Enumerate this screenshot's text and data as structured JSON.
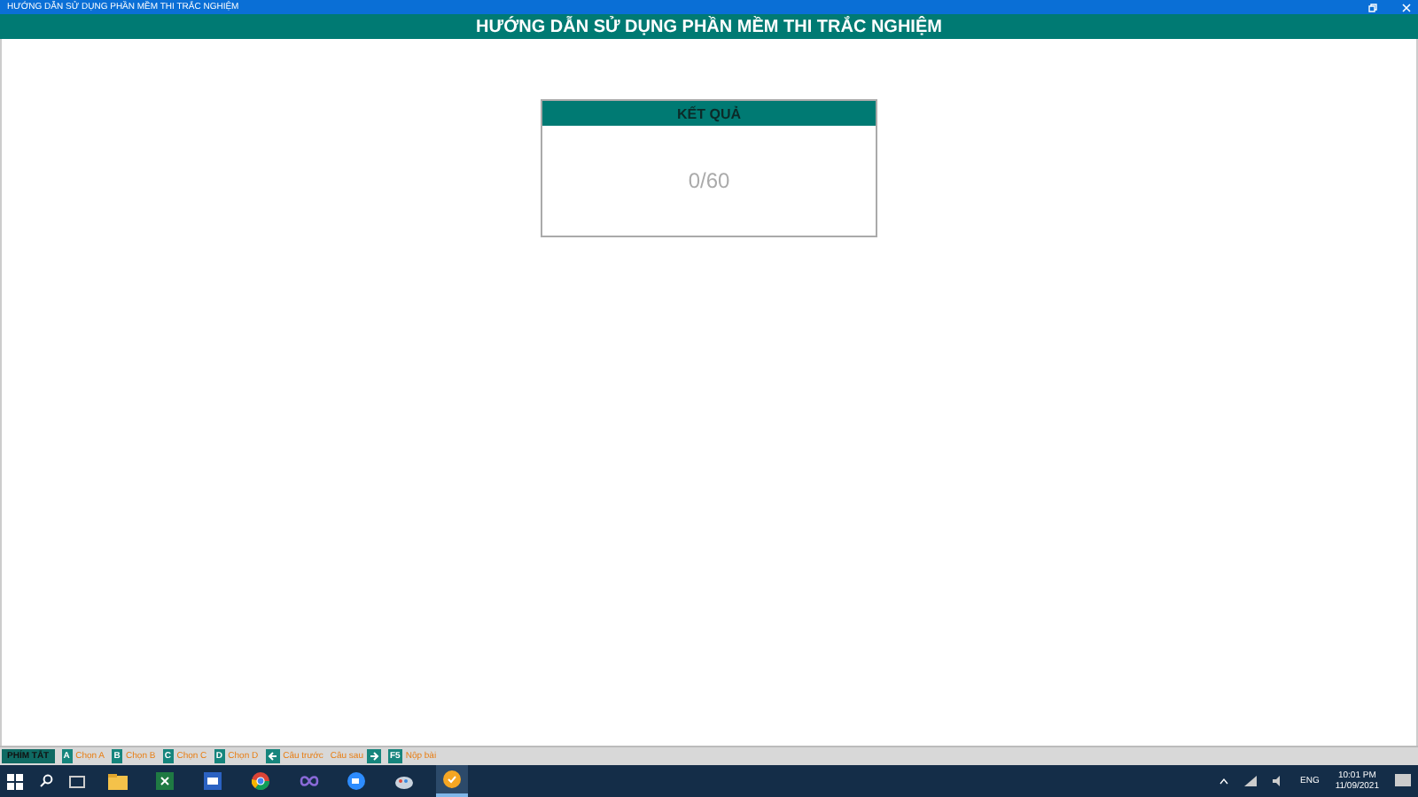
{
  "window": {
    "title": "HƯỚNG DẪN SỬ DỤNG PHẦN MỀM THI TRẮC NGHIỆM"
  },
  "header": {
    "title": "HƯỚNG DẪN SỬ DỤNG PHẦN MỀM THI TRẮC NGHIỆM"
  },
  "result_card": {
    "title": "KẾT QUẢ",
    "score": "0/60"
  },
  "shortcuts": {
    "label": "PHÍM TẮT",
    "items": [
      {
        "kind": "key",
        "key": "A",
        "text": "Chọn A"
      },
      {
        "kind": "key",
        "key": "B",
        "text": "Chọn B"
      },
      {
        "kind": "key",
        "key": "C",
        "text": "Chọn C"
      },
      {
        "kind": "key",
        "key": "D",
        "text": "Chọn D"
      },
      {
        "kind": "left",
        "text": "Câu trước"
      },
      {
        "kind": "right",
        "text": "Câu sau"
      },
      {
        "kind": "key",
        "key": "F5",
        "text": "Nộp bài"
      }
    ]
  },
  "taskbar": {
    "language": "ENG",
    "time": "10:01 PM",
    "date": "11/09/2021"
  }
}
